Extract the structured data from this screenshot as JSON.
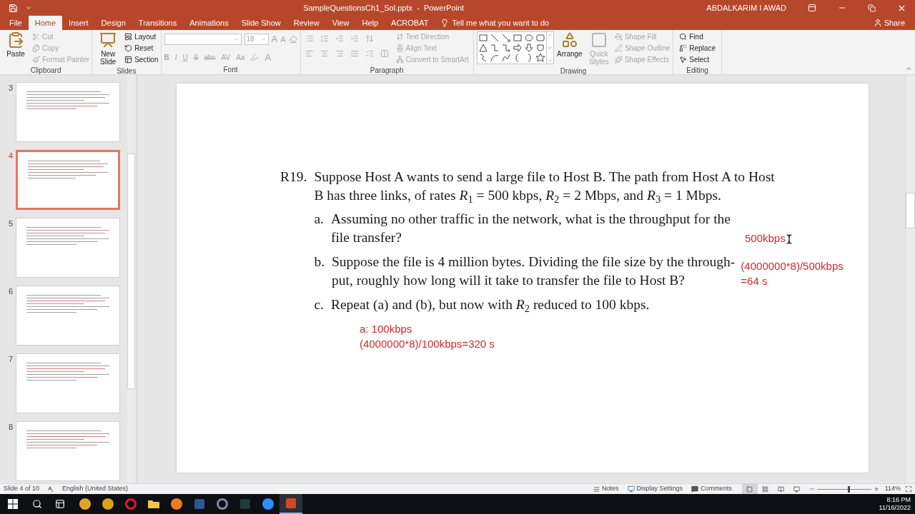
{
  "title_bar": {
    "title": "SampleQuestionsCh1_Sol.pptx  -  PowerPoint",
    "user": "ABDALKARIM I AWAD"
  },
  "tabs": [
    {
      "label": "File",
      "selected": false
    },
    {
      "label": "Home",
      "selected": true
    },
    {
      "label": "Insert",
      "selected": false
    },
    {
      "label": "Design",
      "selected": false
    },
    {
      "label": "Transitions",
      "selected": false
    },
    {
      "label": "Animations",
      "selected": false
    },
    {
      "label": "Slide Show",
      "selected": false
    },
    {
      "label": "Review",
      "selected": false
    },
    {
      "label": "View",
      "selected": false
    },
    {
      "label": "Help",
      "selected": false
    },
    {
      "label": "ACROBAT",
      "selected": false
    }
  ],
  "tell_me": {
    "placeholder": "Tell me what you want to do"
  },
  "share": "Share",
  "ribbon": [
    {
      "kind": "clipboard",
      "label": "Clipboard",
      "large": [
        {
          "label": "Paste",
          "disabled": false
        }
      ],
      "small": [
        {
          "label": "Cut",
          "disabled": true
        },
        {
          "label": "Copy",
          "disabled": true
        },
        {
          "label": "Format Painter",
          "disabled": true
        }
      ]
    },
    {
      "kind": "slides",
      "label": "Slides",
      "large": [
        {
          "label": "New Slide",
          "disabled": false
        }
      ],
      "small": [
        {
          "label": "Layout",
          "disabled": false
        },
        {
          "label": "Reset",
          "disabled": false
        },
        {
          "label": "Section",
          "disabled": false
        }
      ]
    },
    {
      "kind": "font",
      "label": "Font",
      "disabled": true,
      "size": "18",
      "size_buttons": [
        "A",
        "A"
      ],
      "format_buttons": [
        "B",
        "I",
        "U",
        "S",
        "abc",
        "AV",
        "Aa"
      ],
      "color_button": "A"
    },
    {
      "kind": "paragraph",
      "label": "Paragraph",
      "disabled": true,
      "small": [
        {
          "label": "Text Direction",
          "disabled": true
        },
        {
          "label": "Align Text",
          "disabled": true
        },
        {
          "label": "Convert to SmartArt",
          "disabled": true
        }
      ]
    },
    {
      "kind": "drawing",
      "label": "Drawing",
      "large": [
        {
          "label": "Arrange",
          "disabled": false
        },
        {
          "label": "Quick Styles",
          "disabled": true
        }
      ],
      "small": [
        {
          "label": "Shape Fill",
          "disabled": true
        },
        {
          "label": "Shape Outline",
          "disabled": true
        },
        {
          "label": "Shape Effects",
          "disabled": true
        }
      ]
    },
    {
      "kind": "editing",
      "label": "Editing",
      "small": [
        {
          "label": "Find",
          "disabled": false
        },
        {
          "label": "Replace",
          "disabled": false
        },
        {
          "label": "Select",
          "disabled": false
        }
      ]
    }
  ],
  "thumbnails": [
    {
      "number": "3",
      "selected": false
    },
    {
      "number": "4",
      "selected": true
    },
    {
      "number": "5",
      "selected": false
    },
    {
      "number": "6",
      "selected": false
    },
    {
      "number": "7",
      "selected": false
    },
    {
      "number": "8",
      "selected": false
    }
  ],
  "slide": {
    "problem_number": "R19.",
    "problem_lines": [
      "Suppose Host A wants to send a large file to Host B. The path from Host A to Host",
      "B has three links, of rates *R*$_{1}$ = 500 kbps, *R*$_{2}$ = 2 Mbps, and *R*$_{3}$ = 1 Mbps."
    ],
    "parts": [
      {
        "letter": "a.",
        "lines": [
          "Assuming no other traffic in the network, what is the throughput for the",
          "file transfer?"
        ],
        "answer": [
          "500kbps"
        ],
        "kind": "inline",
        "pointer": true
      },
      {
        "letter": "b.",
        "lines": [
          "Suppose the file is 4 million bytes. Dividing the file size by the through-",
          "put, roughly how long will it take to transfer the file to Host B?"
        ],
        "answer": [
          "(4000000*8)/500kbps",
          "=64 s"
        ],
        "kind": "inline",
        "pointer": false
      },
      {
        "letter": "c.",
        "lines": [
          "Repeat (a) and (b), but now with *R*$_{2}$ reduced to 100 kbps."
        ],
        "answer": [
          "a: 100kbps",
          "(4000000*8)/100kbps=320 s"
        ],
        "kind": "below",
        "pointer": false
      }
    ]
  },
  "status_bar": {
    "slide_info": "Slide 4 of 10",
    "language": "English (United States)",
    "notes": "Notes",
    "display_settings": "Display Settings",
    "comments": "Comments",
    "views": [
      {
        "kind": "normal",
        "selected": true
      },
      {
        "kind": "sorter",
        "selected": false
      },
      {
        "kind": "reading",
        "selected": false
      },
      {
        "kind": "slideshow",
        "selected": false
      }
    ],
    "zoom": {
      "level": 0.58,
      "reading": "114%"
    }
  },
  "taskbar": {
    "apps": [
      {
        "kind": "circle",
        "color": "#e0a526",
        "selected": false
      },
      {
        "kind": "circle",
        "color": "#d8a31b",
        "selected": false
      },
      {
        "kind": "ring",
        "color": "#e3182d",
        "selected": false
      },
      {
        "kind": "folder",
        "color": "#f3c341",
        "selected": false
      },
      {
        "kind": "circle",
        "color": "#ef7b1e",
        "selected": false
      },
      {
        "kind": "square",
        "color": "#2b5797",
        "selected": false
      },
      {
        "kind": "ring",
        "color": "#7a8aa0",
        "selected": false
      },
      {
        "kind": "square",
        "color": "#1c3b3a",
        "selected": false
      },
      {
        "kind": "circle",
        "color": "#2d8cff",
        "selected": false
      },
      {
        "kind": "square",
        "color": "#d24726",
        "selected": true
      }
    ],
    "time": "8:16 PM",
    "date": "11/16/2022"
  }
}
